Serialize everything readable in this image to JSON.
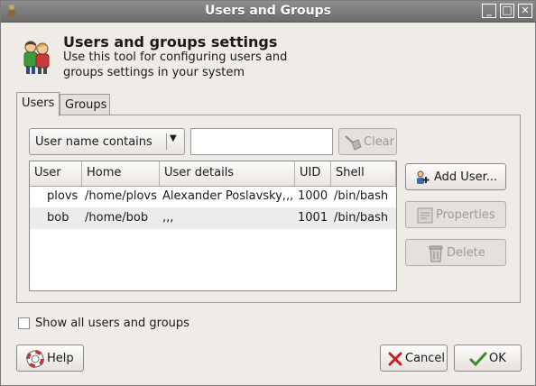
{
  "window": {
    "title": "Users and Groups",
    "minimize": "_",
    "maximize": "□",
    "close": "✕"
  },
  "header": {
    "title": "Users and groups settings",
    "description_line1": "Use this tool for configuring users and",
    "description_line2": "groups settings in your system"
  },
  "tabs": [
    {
      "label": "Users",
      "active": true
    },
    {
      "label": "Groups",
      "active": false
    }
  ],
  "filter": {
    "selected": "User name contains",
    "search_value": "",
    "clear_label": "Clear"
  },
  "table": {
    "columns": [
      "User",
      "Home",
      "User details",
      "UID",
      "Shell"
    ],
    "rows": [
      {
        "user": "plovs",
        "home": "/home/plovs",
        "details": "Alexander Poslavsky,,,",
        "uid": "1000",
        "shell": "/bin/bash"
      },
      {
        "user": "bob",
        "home": "/home/bob",
        "details": ",,,",
        "uid": "1001",
        "shell": "/bin/bash"
      }
    ]
  },
  "actions": {
    "add_user": "Add User...",
    "properties": "Properties",
    "delete": "Delete"
  },
  "show_all": {
    "label": "Show all users and groups",
    "checked": false
  },
  "footer": {
    "help": "Help",
    "cancel": "Cancel",
    "ok": "OK"
  },
  "colors": {
    "titlebar": "#7d7d7d",
    "background": "#efebe7",
    "row_alt": "#ececec"
  }
}
